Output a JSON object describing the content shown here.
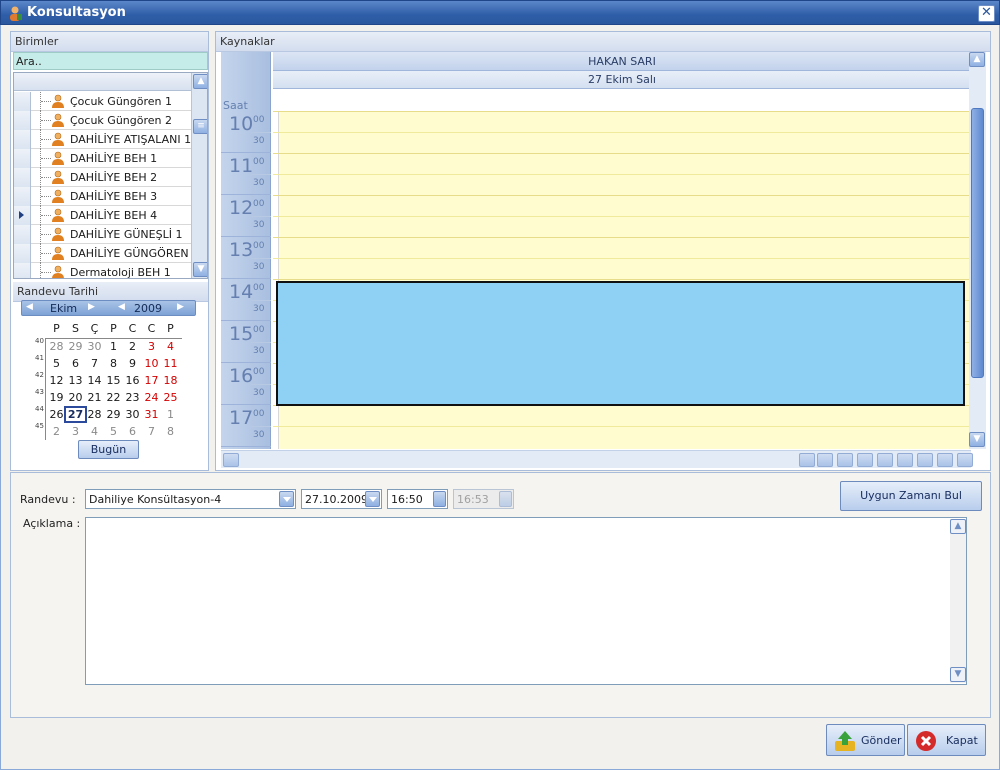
{
  "window": {
    "title": "Konsultasyon"
  },
  "birimler": {
    "header": "Birimler",
    "search_placeholder": "Ara..",
    "items": [
      {
        "label": "Çocuk Güngören 1",
        "selected": false
      },
      {
        "label": "Çocuk Güngören 2",
        "selected": false
      },
      {
        "label": "DAHİLİYE ATIŞALANI 1",
        "selected": false
      },
      {
        "label": "DAHİLİYE BEH 1",
        "selected": false
      },
      {
        "label": "DAHİLİYE BEH 2",
        "selected": false
      },
      {
        "label": "DAHİLİYE BEH 3",
        "selected": false
      },
      {
        "label": "DAHİLİYE BEH 4",
        "selected": true
      },
      {
        "label": "DAHİLİYE GÜNEŞLİ 1",
        "selected": false
      },
      {
        "label": "DAHİLİYE GÜNGÖREN 1",
        "selected": false
      },
      {
        "label": "Dermatoloji BEH 1",
        "selected": false
      }
    ]
  },
  "calendar": {
    "header": "Randevu Tarihi",
    "month": "Ekim",
    "year": "2009",
    "weekdays": [
      "P",
      "S",
      "Ç",
      "P",
      "C",
      "C",
      "P"
    ],
    "weeks": [
      {
        "num": "40",
        "days": [
          "28",
          "29",
          "30",
          "1",
          "2",
          "3",
          "4"
        ]
      },
      {
        "num": "41",
        "days": [
          "5",
          "6",
          "7",
          "8",
          "9",
          "10",
          "11"
        ]
      },
      {
        "num": "42",
        "days": [
          "12",
          "13",
          "14",
          "15",
          "16",
          "17",
          "18"
        ]
      },
      {
        "num": "43",
        "days": [
          "19",
          "20",
          "21",
          "22",
          "23",
          "24",
          "25"
        ]
      },
      {
        "num": "44",
        "days": [
          "26",
          "27",
          "28",
          "29",
          "30",
          "31",
          "1"
        ]
      },
      {
        "num": "45",
        "days": [
          "2",
          "3",
          "4",
          "5",
          "6",
          "7",
          "8"
        ]
      }
    ],
    "today": "27",
    "today_button": "Bugün",
    "weekend_color": "#d40000",
    "other_month_color": "#8a8a8a"
  },
  "kaynaklar": {
    "header": "Kaynaklar",
    "resource": "HAKAN SARI",
    "date": "27 Ekim Salı",
    "saat_label": "Saat",
    "hours": [
      {
        "h": "10",
        "m00": "00",
        "m30": "30"
      },
      {
        "h": "11",
        "m00": "00",
        "m30": "30"
      },
      {
        "h": "12",
        "m00": "00",
        "m30": "30"
      },
      {
        "h": "13",
        "m00": "00",
        "m30": "30"
      },
      {
        "h": "14",
        "m00": "00",
        "m30": "30"
      },
      {
        "h": "15",
        "m00": "00",
        "m30": "30"
      },
      {
        "h": "16",
        "m00": "00",
        "m30": "30"
      },
      {
        "h": "17",
        "m00": "00",
        "m30": "30"
      }
    ],
    "appointment_color": "#8ed1f5",
    "grid_color": "#fffcd0"
  },
  "form": {
    "randevu_label": "Randevu :",
    "randevu_value": "Dahiliye Konsültasyon-4",
    "date_value": "27.10.2009",
    "start_time": "16:50",
    "end_time": "16:53",
    "find_button": "Uygun Zamanı Bul",
    "aciklama_label": "Açıklama :",
    "aciklama_value": ""
  },
  "buttons": {
    "send": "Gönder",
    "close": "Kapat"
  }
}
